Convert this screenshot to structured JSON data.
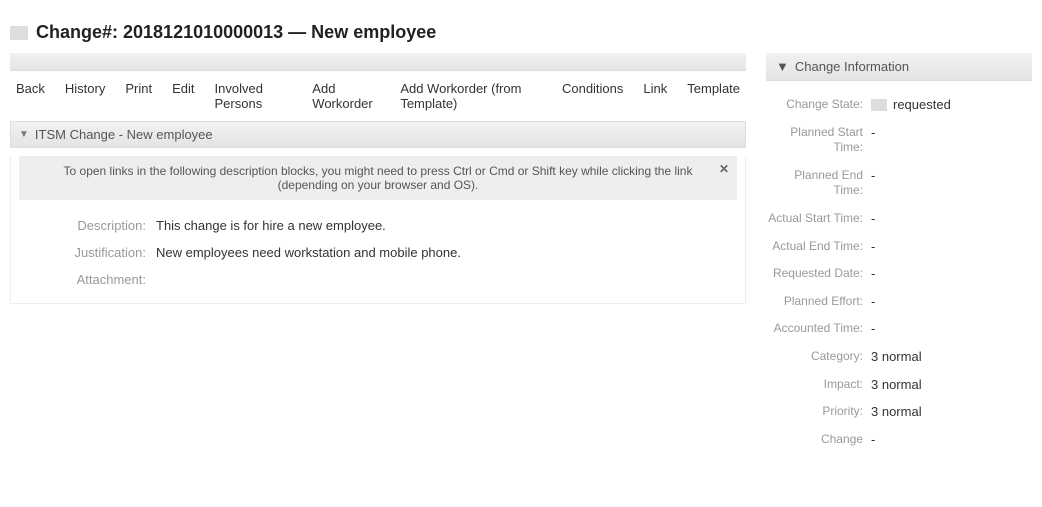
{
  "title": "Change#: 2018121010000013  —  New employee",
  "menu": {
    "back": "Back",
    "history": "History",
    "print": "Print",
    "edit": "Edit",
    "involved": "Involved Persons",
    "addwo": "Add Workorder",
    "addwot": "Add Workorder (from Template)",
    "conditions": "Conditions",
    "link": "Link",
    "template": "Template"
  },
  "panel": {
    "header": "ITSM Change - New employee",
    "note": "To open links in the following description blocks, you might need to press Ctrl or Cmd or Shift key while clicking the link (depending on your browser and OS).",
    "note_close": "✕",
    "labels": {
      "description": "Description:",
      "justification": "Justification:",
      "attachment": "Attachment:"
    },
    "values": {
      "description": "This change is for hire a new employee.",
      "justification": "New employees need workstation and mobile phone.",
      "attachment": ""
    }
  },
  "side": {
    "header": "Change Information",
    "rows": [
      {
        "label": "Change State:",
        "value": "requested",
        "flag": true
      },
      {
        "label": "Planned Start Time:",
        "value": "-"
      },
      {
        "label": "Planned End Time:",
        "value": "-"
      },
      {
        "label": "Actual Start Time:",
        "value": "-"
      },
      {
        "label": "Actual End Time:",
        "value": "-"
      },
      {
        "label": "Requested Date:",
        "value": "-"
      },
      {
        "label": "Planned Effort:",
        "value": "-"
      },
      {
        "label": "Accounted Time:",
        "value": "-"
      },
      {
        "label": "Category:",
        "value": "3 normal"
      },
      {
        "label": "Impact:",
        "value": "3 normal"
      },
      {
        "label": "Priority:",
        "value": "3 normal"
      },
      {
        "label": "Change",
        "value": "-"
      }
    ]
  }
}
